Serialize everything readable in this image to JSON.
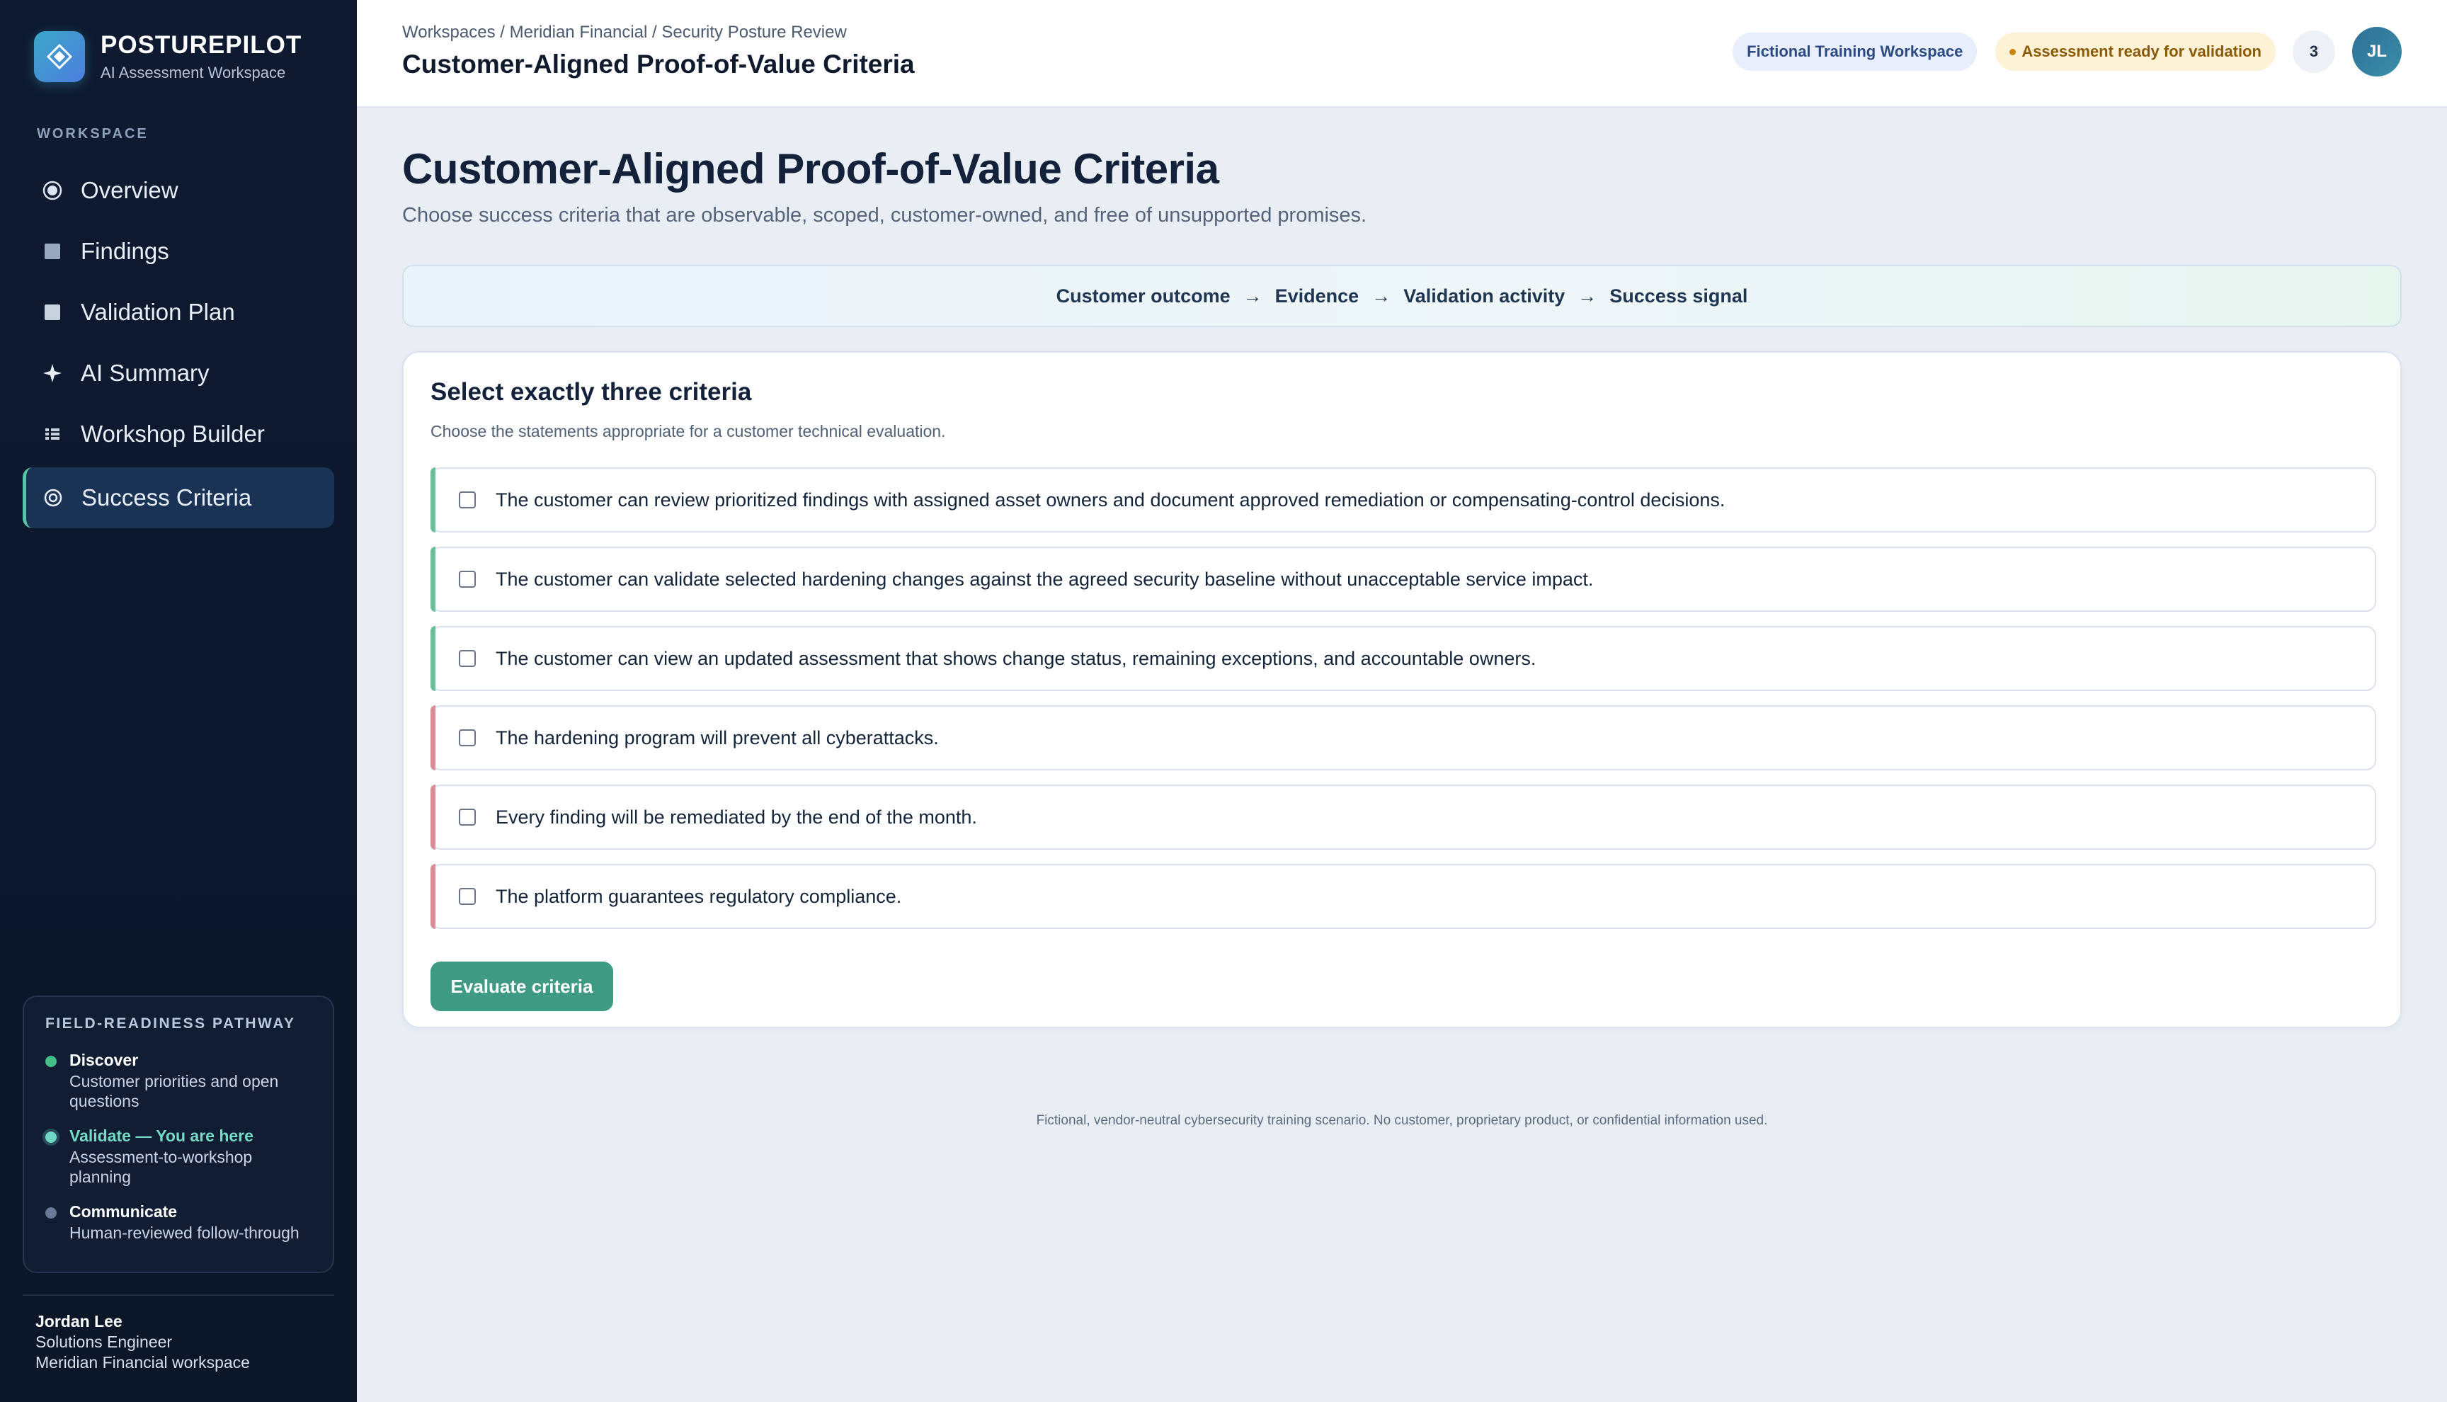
{
  "brand": {
    "name": "POSTUREPILOT",
    "subtitle": "AI Assessment Workspace"
  },
  "sidebar": {
    "section_label": "WORKSPACE",
    "items": [
      {
        "label": "Overview",
        "icon": "radio-circle-icon"
      },
      {
        "label": "Findings",
        "icon": "square-icon"
      },
      {
        "label": "Validation Plan",
        "icon": "square-icon"
      },
      {
        "label": "AI Summary",
        "icon": "sparkle-icon"
      },
      {
        "label": "Workshop Builder",
        "icon": "grid-icon"
      },
      {
        "label": "Success Criteria",
        "icon": "target-icon",
        "active": true
      }
    ]
  },
  "pathway": {
    "title": "FIELD-READINESS PATHWAY",
    "steps": [
      {
        "title": "Discover",
        "desc": "Customer priorities and open questions"
      },
      {
        "title": "Validate — You are here",
        "desc": "Assessment-to-workshop planning"
      },
      {
        "title": "Communicate",
        "desc": "Human-reviewed follow-through"
      }
    ]
  },
  "user": {
    "name": "Jordan Lee",
    "role": "Solutions Engineer",
    "workspace": "Meridian Financial workspace"
  },
  "header": {
    "breadcrumb": "Workspaces / Meridian Financial / Security Posture Review",
    "title": "Customer-Aligned Proof-of-Value Criteria",
    "workspace_chip": "Fictional Training Workspace",
    "status_chip": "Assessment ready for validation",
    "count": "3",
    "avatar_initials": "JL"
  },
  "main": {
    "title": "Customer-Aligned Proof-of-Value Criteria",
    "subtitle": "Choose success criteria that are observable, scoped, customer-owned, and free of unsupported promises.",
    "flow": [
      "Customer outcome",
      "Evidence",
      "Validation activity",
      "Success signal"
    ],
    "flow_arrow": "→",
    "card": {
      "title": "Select exactly three criteria",
      "subtitle": "Choose the statements appropriate for a customer technical evaluation.",
      "options": [
        "The customer can review prioritized findings with assigned asset owners and document approved remediation or compensating-control decisions.",
        "The customer can validate selected hardening changes against the agreed security baseline without unacceptable service impact.",
        "The customer can view an updated assessment that shows change status, remaining exceptions, and accountable owners.",
        "The hardening program will prevent all cyberattacks.",
        "Every finding will be remediated by the end of the month.",
        "The platform guarantees regulatory compliance."
      ],
      "button": "Evaluate criteria"
    },
    "footer": "Fictional, vendor-neutral cybersecurity training scenario. No customer, proprietary product, or confidential information used."
  },
  "colors": {
    "sidebar_bg": "#0e1a30",
    "accent_teal": "#3f9a83",
    "good_bar": "#6dbf9c",
    "bad_bar": "#d98f94",
    "status_amber": "#fdf2d6"
  }
}
